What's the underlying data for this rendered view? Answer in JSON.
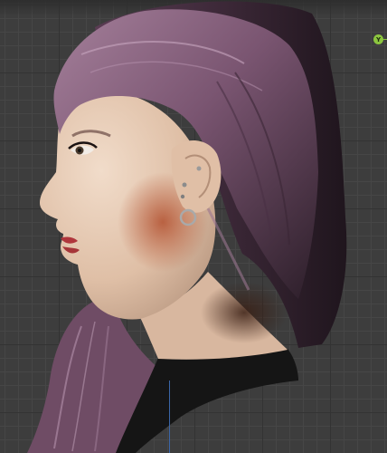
{
  "viewport": {
    "axis_gizmo": {
      "label": "Y",
      "color": "#8cc63f",
      "icon": "y-axis-icon"
    },
    "colors": {
      "grid_bg": "#3d3d3d",
      "hair": "#7a5570",
      "skin": "#e3c2aa",
      "blush": "#b45a3a",
      "clothing": "#141414"
    }
  }
}
